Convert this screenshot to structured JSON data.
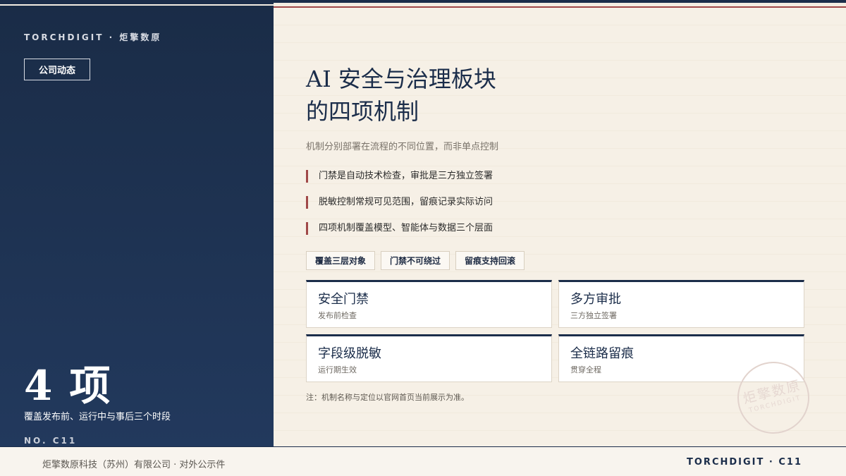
{
  "sidebar": {
    "brand": "TORCHDIGIT · 炬擎数原",
    "tag": "公司动态",
    "count": "4 项",
    "count_desc": "覆盖发布前、运行中与事后三个时段",
    "code": "NO. C11"
  },
  "main": {
    "title_line1": "AI 安全与治理板块",
    "title_line2": "的四项机制",
    "subtitle": "机制分别部署在流程的不同位置，而非单点控制",
    "bullets": [
      "门禁是自动技术检查，审批是三方独立签署",
      "脱敏控制常规可见范围，留痕记录实际访问",
      "四项机制覆盖模型、智能体与数据三个层面"
    ],
    "chips": [
      "覆盖三层对象",
      "门禁不可绕过",
      "留痕支持回滚"
    ],
    "cards": [
      {
        "title": "安全门禁",
        "sub": "发布前检查"
      },
      {
        "title": "多方审批",
        "sub": "三方独立签署"
      },
      {
        "title": "字段级脱敏",
        "sub": "运行期生效"
      },
      {
        "title": "全链路留痕",
        "sub": "贯穿全程"
      }
    ],
    "note": "注：机制名称与定位以官网首页当前展示为准。",
    "seal_cn": "炬擎数原",
    "seal_en": "TORCHDIGIT"
  },
  "footer": {
    "left": "炬擎数原科技（苏州）有限公司 · 对外公示件",
    "right": "TORCHDIGIT · C11"
  },
  "colors": {
    "navy": "#1b2d4a",
    "accent_red": "#a04848",
    "paper": "#f4ede2"
  }
}
